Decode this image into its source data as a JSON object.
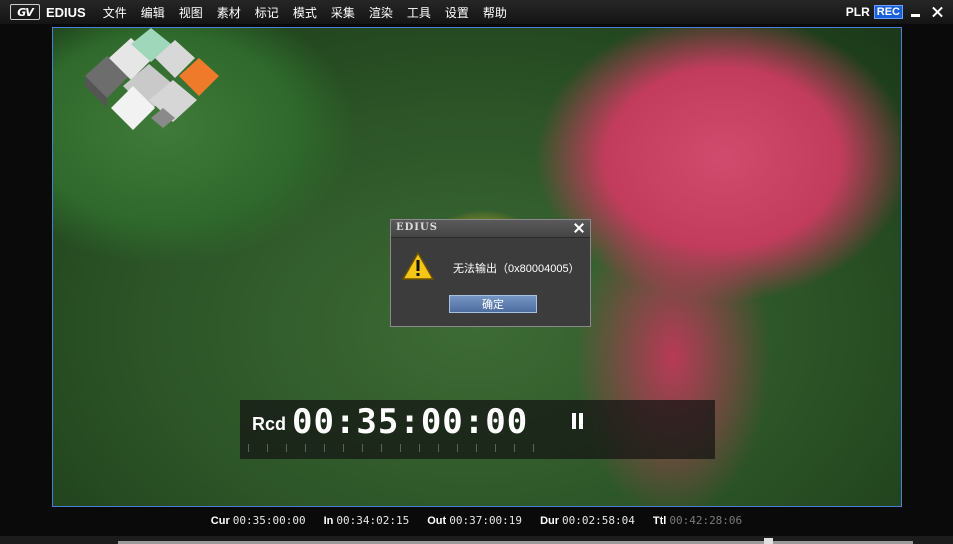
{
  "app": {
    "logo": "GV",
    "title": "EDIUS",
    "menu": [
      "文件",
      "编辑",
      "视图",
      "素材",
      "标记",
      "模式",
      "采集",
      "渲染",
      "工具",
      "设置",
      "帮助"
    ],
    "plr_label": "PLR",
    "rec_label": "REC"
  },
  "viewer": {
    "timecode_label": "Rcd",
    "timecode": "00:35:00:00"
  },
  "dialog": {
    "title": "EDIUS",
    "message": "无法输出（0x80004005）",
    "ok_label": "确定"
  },
  "status": {
    "cur_label": "Cur",
    "cur": "00:35:00:00",
    "in_label": "In",
    "in": "00:34:02:15",
    "out_label": "Out",
    "out": "00:37:00:19",
    "dur_label": "Dur",
    "dur": "00:02:58:04",
    "ttl_label": "Ttl",
    "ttl": "00:42:28:06"
  },
  "colors": {
    "rec_badge": "#1760d8",
    "frame_border": "#4a7fd8",
    "dialog_button": "#5f80b2"
  }
}
